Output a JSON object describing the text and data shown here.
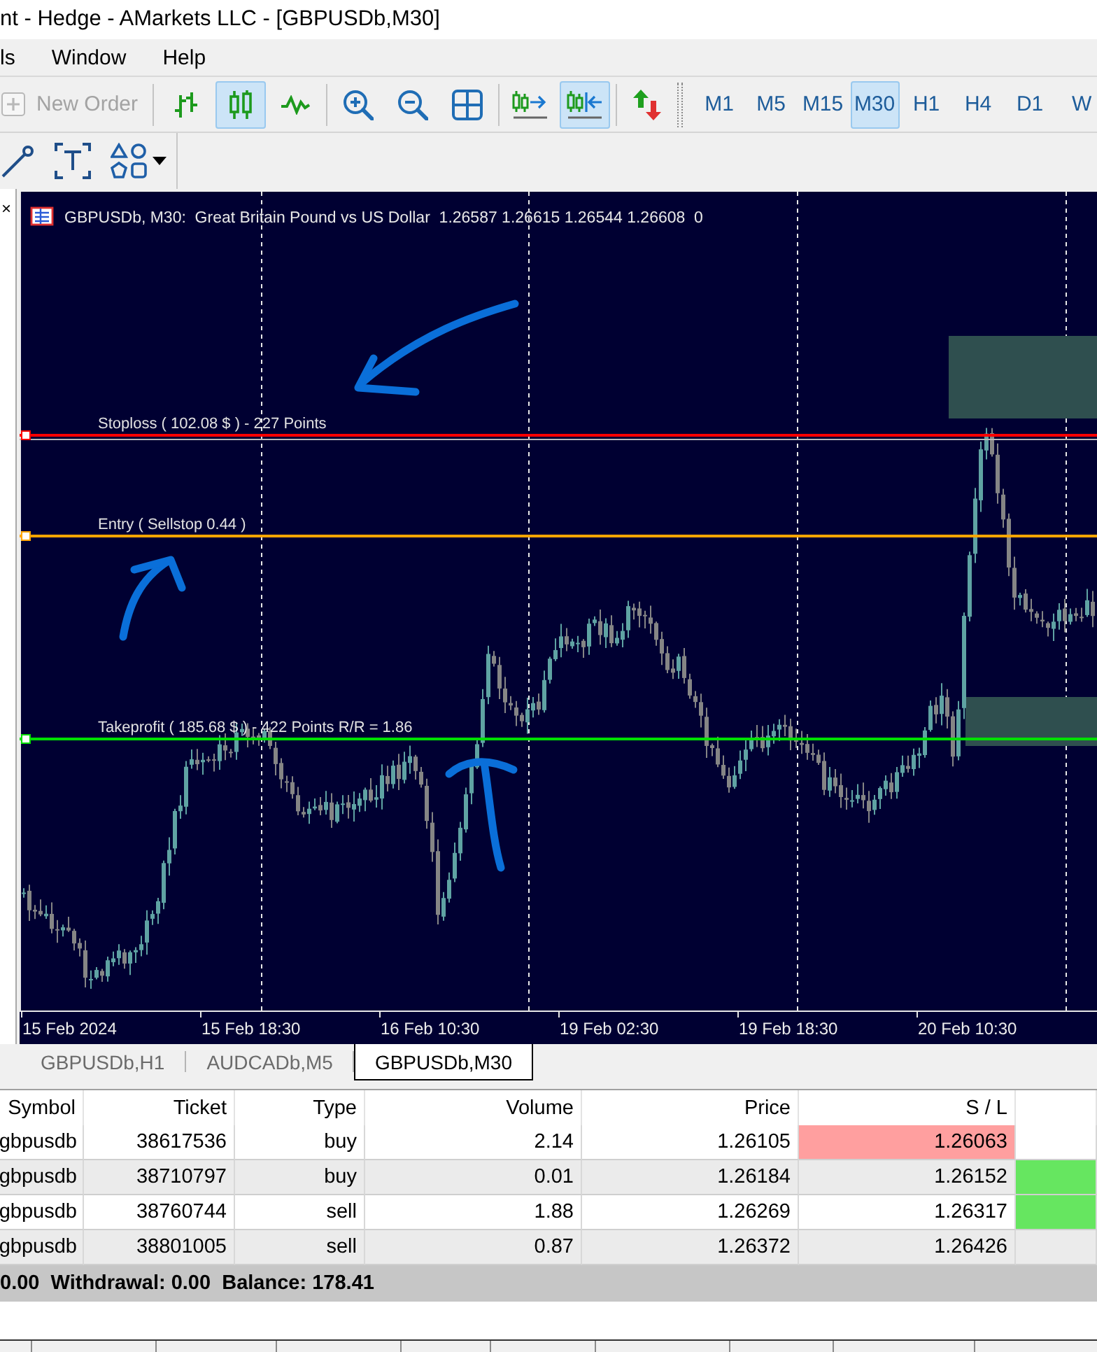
{
  "window": {
    "title": "nt - Hedge - AMarkets LLC - [GBPUSDb,M30]"
  },
  "menu": [
    {
      "label": "ls"
    },
    {
      "label": "Window"
    },
    {
      "label": "Help"
    }
  ],
  "toolbar": {
    "new_order": {
      "label": "New Order",
      "disabled": true
    },
    "groups": [
      [
        {
          "kind": "bars",
          "selected": false
        },
        {
          "kind": "candles",
          "selected": true
        },
        {
          "kind": "line",
          "selected": false
        }
      ],
      [
        {
          "kind": "zoom-in"
        },
        {
          "kind": "zoom-out"
        },
        {
          "kind": "tile"
        }
      ],
      [
        {
          "kind": "chart-shift",
          "on": false
        },
        {
          "kind": "auto-scroll",
          "on": true
        }
      ],
      [
        {
          "kind": "one-click-trading"
        }
      ]
    ],
    "timeframes": [
      {
        "label": "M1",
        "selected": false
      },
      {
        "label": "M5",
        "selected": false
      },
      {
        "label": "M15",
        "selected": false
      },
      {
        "label": "M30",
        "selected": true
      },
      {
        "label": "H1",
        "selected": false
      },
      {
        "label": "H4",
        "selected": false
      },
      {
        "label": "D1",
        "selected": false
      },
      {
        "label": "W",
        "selected": false
      }
    ]
  },
  "drawing_tools": [
    {
      "kind": "trend-line"
    },
    {
      "kind": "text"
    },
    {
      "kind": "shapes"
    }
  ],
  "side_panel": {
    "close": "×"
  },
  "chart": {
    "header": "GBPUSDb, M30:  Great Britain Pound vs US Dollar  1.26587 1.26615 1.26544 1.26608  0",
    "levels": [
      {
        "kind": "stoploss",
        "label": "Stoploss ( 102.08 $ ) - 227 Points",
        "color": "#ff0000"
      },
      {
        "kind": "entry",
        "label": "Entry ( Sellstop 0.44 )",
        "color": "#ffa500"
      },
      {
        "kind": "takeprofit",
        "label": "Takeprofit ( 185.68 $ ) - 422 Points R/R = 1.86",
        "color": "#00e000"
      }
    ],
    "annotations": [
      {
        "kind": "arrow-down-left"
      },
      {
        "kind": "arrow-up-right"
      },
      {
        "kind": "arrow-up"
      }
    ],
    "time_axis": [
      "15 Feb 2024",
      "15 Feb 18:30",
      "16 Feb 10:30",
      "19 Feb 02:30",
      "19 Feb 18:30",
      "20 Feb 10:30"
    ]
  },
  "chart_tabs": [
    {
      "label": "GBPUSDb,H1",
      "selected": false
    },
    {
      "label": "AUDCADb,M5",
      "selected": false
    },
    {
      "label": "GBPUSDb,M30",
      "selected": true
    }
  ],
  "trades": {
    "columns": [
      "Symbol",
      "Ticket",
      "Type",
      "Volume",
      "Price",
      "S / L"
    ],
    "rows": [
      {
        "cells": [
          {
            "text": "gbpusdb"
          },
          {
            "text": "38617536"
          },
          {
            "text": "buy"
          },
          {
            "text": "2.14"
          },
          {
            "text": "1.26105"
          },
          {
            "text": "1.26063",
            "color": "#ff9f9f"
          }
        ]
      },
      {
        "cells": [
          {
            "text": "gbpusdb"
          },
          {
            "text": "38710797"
          },
          {
            "text": "buy"
          },
          {
            "text": "0.01"
          },
          {
            "text": "1.26184"
          },
          {
            "text": "1.26152"
          },
          {
            "color": "#66e660"
          }
        ]
      },
      {
        "cells": [
          {
            "text": "gbpusdb"
          },
          {
            "text": "38760744"
          },
          {
            "text": "sell"
          },
          {
            "text": "1.88"
          },
          {
            "text": "1.26269"
          },
          {
            "text": "1.26317"
          },
          {
            "color": "#66e660"
          }
        ]
      },
      {
        "cells": [
          {
            "text": "gbpusdb"
          },
          {
            "text": "38801005"
          },
          {
            "text": "sell"
          },
          {
            "text": "0.87"
          },
          {
            "text": "1.26372"
          },
          {
            "text": "1.26426"
          }
        ]
      }
    ]
  },
  "summary": "0.00  Withdrawal: 0.00  Balance: 178.41"
}
